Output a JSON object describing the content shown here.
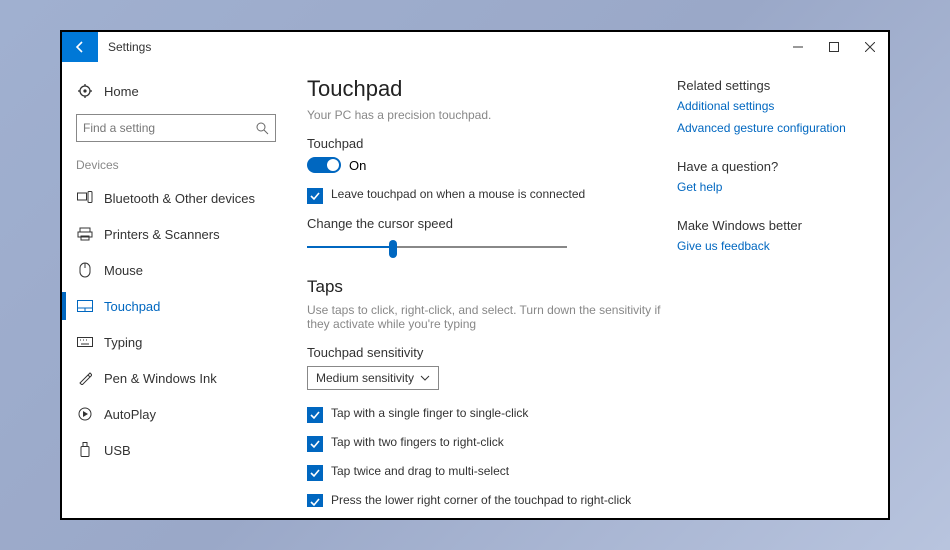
{
  "window": {
    "title": "Settings"
  },
  "sidebar": {
    "home": "Home",
    "search_placeholder": "Find a setting",
    "section": "Devices",
    "items": [
      {
        "label": "Bluetooth & Other devices"
      },
      {
        "label": "Printers & Scanners"
      },
      {
        "label": "Mouse"
      },
      {
        "label": "Touchpad"
      },
      {
        "label": "Typing"
      },
      {
        "label": "Pen & Windows Ink"
      },
      {
        "label": "AutoPlay"
      },
      {
        "label": "USB"
      }
    ]
  },
  "main": {
    "title": "Touchpad",
    "precision_note": "Your PC has a precision touchpad.",
    "toggle_label": "Touchpad",
    "toggle_state": "On",
    "leave_on_label": "Leave touchpad on when a mouse is connected",
    "cursor_speed_label": "Change the cursor speed",
    "taps": {
      "heading": "Taps",
      "desc": "Use taps to click, right-click, and select. Turn down the sensitivity if they activate while you're typing",
      "sensitivity_label": "Touchpad sensitivity",
      "sensitivity_value": "Medium sensitivity",
      "checks": [
        "Tap with a single finger to single-click",
        "Tap with two fingers to right-click",
        "Tap twice and drag to multi-select",
        "Press the lower right corner of the touchpad to right-click"
      ]
    }
  },
  "aside": {
    "related_heading": "Related settings",
    "related_links": [
      "Additional settings",
      "Advanced gesture configuration"
    ],
    "question_heading": "Have a question?",
    "question_link": "Get help",
    "feedback_heading": "Make Windows better",
    "feedback_link": "Give us feedback"
  }
}
